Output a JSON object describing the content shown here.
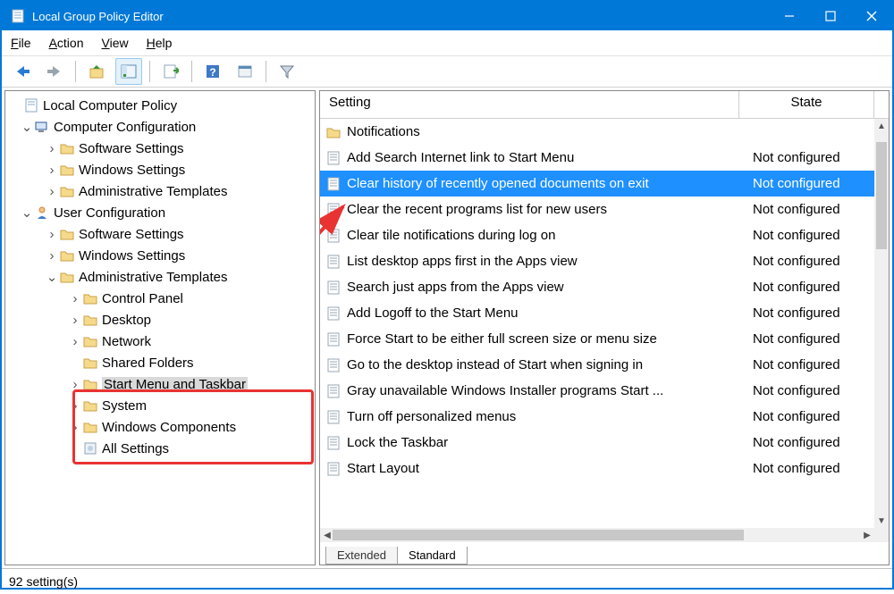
{
  "window": {
    "title": "Local Group Policy Editor"
  },
  "menu": {
    "file": "File",
    "action": "Action",
    "view": "View",
    "help": "Help"
  },
  "tree": {
    "root": "Local Computer Policy",
    "cc": "Computer Configuration",
    "cc_sw": "Software Settings",
    "cc_ws": "Windows Settings",
    "cc_at": "Administrative Templates",
    "uc": "User Configuration",
    "uc_sw": "Software Settings",
    "uc_ws": "Windows Settings",
    "uc_at": "Administrative Templates",
    "cp": "Control Panel",
    "desktop": "Desktop",
    "network": "Network",
    "shared": "Shared Folders",
    "smtb": "Start Menu and Taskbar",
    "system": "System",
    "wincomp": "Windows Components",
    "allset": "All Settings"
  },
  "columns": {
    "setting": "Setting",
    "state": "State"
  },
  "settings": [
    {
      "name": "Notifications",
      "state": "",
      "folder": true
    },
    {
      "name": "Add Search Internet link to Start Menu",
      "state": "Not configured"
    },
    {
      "name": "Clear history of recently opened documents on exit",
      "state": "Not configured",
      "selected": true
    },
    {
      "name": "Clear the recent programs list for new users",
      "state": "Not configured"
    },
    {
      "name": "Clear tile notifications during log on",
      "state": "Not configured"
    },
    {
      "name": "List desktop apps first in the Apps view",
      "state": "Not configured"
    },
    {
      "name": "Search just apps from the Apps view",
      "state": "Not configured"
    },
    {
      "name": "Add Logoff to the Start Menu",
      "state": "Not configured"
    },
    {
      "name": "Force Start to be either full screen size or menu size",
      "state": "Not configured"
    },
    {
      "name": "Go to the desktop instead of Start when signing in",
      "state": "Not configured"
    },
    {
      "name": "Gray unavailable Windows Installer programs Start ...",
      "state": "Not configured"
    },
    {
      "name": "Turn off personalized menus",
      "state": "Not configured"
    },
    {
      "name": "Lock the Taskbar",
      "state": "Not configured"
    },
    {
      "name": "Start Layout",
      "state": "Not configured"
    }
  ],
  "tabs": {
    "extended": "Extended",
    "standard": "Standard"
  },
  "status": "92 setting(s)"
}
